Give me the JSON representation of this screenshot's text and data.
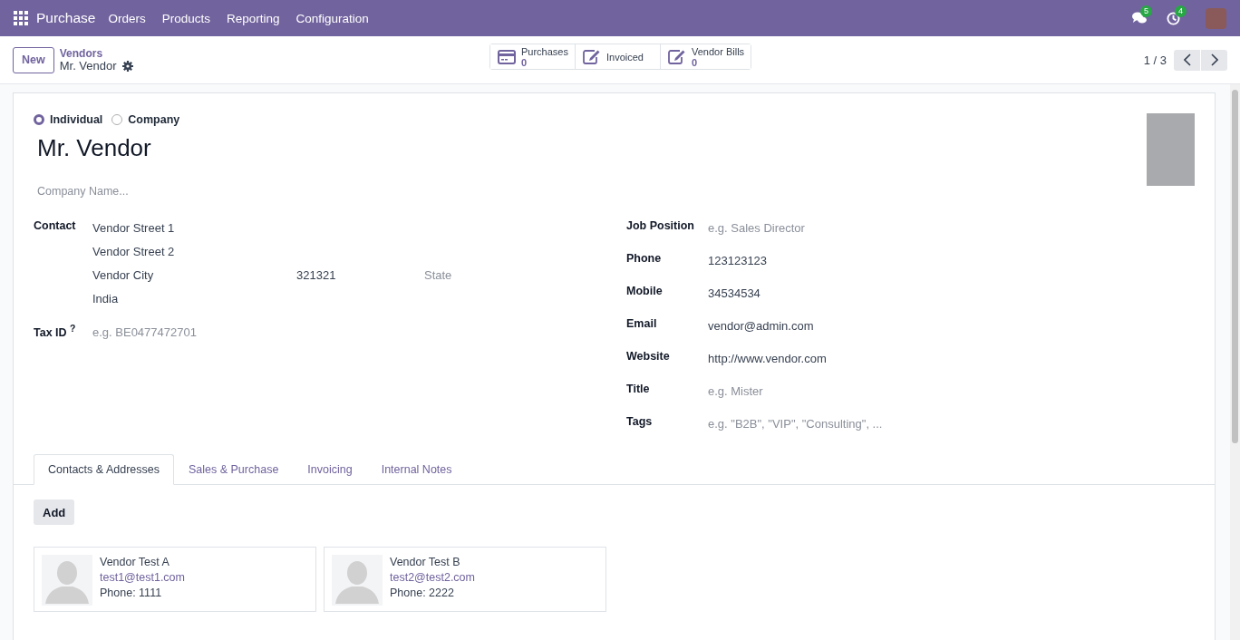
{
  "navbar": {
    "app": "Purchase",
    "menu": [
      "Orders",
      "Products",
      "Reporting",
      "Configuration"
    ],
    "notifications": [
      {
        "kind": "messages",
        "count": "5"
      },
      {
        "kind": "activities",
        "count": "4"
      }
    ]
  },
  "control_panel": {
    "new_button": "New",
    "breadcrumb": {
      "parent": "Vendors",
      "current": "Mr. Vendor"
    },
    "stat_buttons": [
      {
        "kind": "card",
        "label": "Purchases",
        "count": "0"
      },
      {
        "kind": "edit",
        "label": "Invoiced"
      },
      {
        "kind": "edit",
        "label": "Vendor Bills",
        "count": "0"
      }
    ],
    "pager": "1 / 3"
  },
  "form": {
    "partner_type": [
      {
        "label": "Individual",
        "selected": true
      },
      {
        "label": "Company",
        "selected": false
      }
    ],
    "name": "Mr. Vendor",
    "company_name": {
      "placeholder": "Company Name..."
    },
    "contact": {
      "label": "Contact",
      "street": {
        "value": "Vendor Street 1"
      },
      "street2": {
        "value": "Vendor Street 2"
      },
      "city": {
        "value": "Vendor City"
      },
      "zip": {
        "value": "321321"
      },
      "state": {
        "placeholder": "State"
      },
      "country": {
        "value": "India"
      }
    },
    "tax_id": {
      "label": "Tax ID $^{?}$",
      "placeholder": "e.g. BE0477472701"
    },
    "right_fields": [
      {
        "label": "Job Position",
        "placeholder": "e.g. Sales Director"
      },
      {
        "label": "Phone",
        "value": "123123123"
      },
      {
        "label": "Mobile",
        "value": "34534534"
      },
      {
        "label": "Email",
        "value": "vendor@admin.com"
      },
      {
        "label": "Website",
        "value": "http://www.vendor.com"
      },
      {
        "label": "Title",
        "placeholder": "e.g. Mister"
      },
      {
        "label": "Tags",
        "placeholder": "e.g. \"B2B\", \"VIP\", \"Consulting\", ..."
      }
    ],
    "tabs": [
      {
        "label": "Contacts & Addresses",
        "selected": true
      },
      {
        "label": "Sales & Purchase",
        "selected": false
      },
      {
        "label": "Invoicing",
        "selected": false
      },
      {
        "label": "Internal Notes",
        "selected": false
      }
    ],
    "add_button": "Add",
    "contacts": [
      {
        "name": "Vendor Test A",
        "email": "test1@test1.com",
        "phone": "Phone: 1111"
      },
      {
        "name": "Vendor Test B",
        "email": "test2@test2.com",
        "phone": "Phone: 2222"
      }
    ]
  }
}
